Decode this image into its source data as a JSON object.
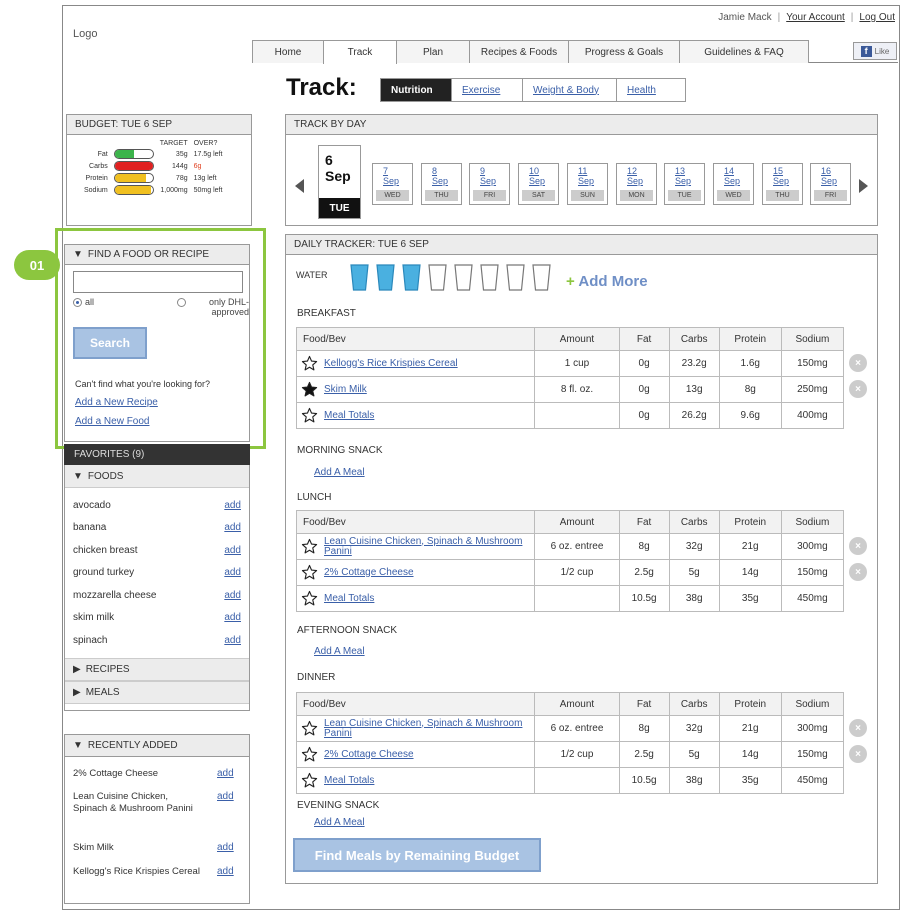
{
  "header": {
    "logo": "Logo",
    "user_name": "Jamie Mack",
    "your_account": "Your Account",
    "logout": "Log Out",
    "fb_like": "Like",
    "tabs": [
      {
        "label": "Home"
      },
      {
        "label": "Track"
      },
      {
        "label": "Plan"
      },
      {
        "label": "Recipes & Foods"
      },
      {
        "label": "Progress & Goals"
      },
      {
        "label": "Guidelines & FAQ"
      }
    ],
    "active_tab": "Track"
  },
  "page": {
    "title": "Track:",
    "subtabs": [
      {
        "label": "Nutrition"
      },
      {
        "label": "Exercise"
      },
      {
        "label": "Weight & Body"
      },
      {
        "label": "Health"
      }
    ],
    "active_subtab": "Nutrition"
  },
  "budget": {
    "header": "BUDGET: TUE 6 SEP",
    "col_target": "TARGET",
    "col_over": "OVER?",
    "rows": [
      {
        "label": "Fat",
        "target": "35g",
        "status": "17.5g left",
        "color": "#3cb44b",
        "fill": 0.5
      },
      {
        "label": "Carbs",
        "target": "144g",
        "status": "6g",
        "color": "#e02020",
        "fill": 1.0,
        "status_color": "#e04020"
      },
      {
        "label": "Protein",
        "target": "78g",
        "status": "13g left",
        "color": "#f0c020",
        "fill": 0.83
      },
      {
        "label": "Sodium",
        "target": "1,000mg",
        "status": "50mg left",
        "color": "#f0c020",
        "fill": 0.95
      }
    ]
  },
  "annotation": {
    "badge": "01"
  },
  "find": {
    "header": "FIND A FOOD OR RECIPE",
    "search_value": "",
    "radio_all": "all",
    "radio_dhl": "only DHL-approved",
    "search_button": "Search",
    "question": "Can't find what you're looking for?",
    "add_recipe": "Add a New Recipe",
    "add_food": "Add a New Food"
  },
  "favorites": {
    "header": "FAVORITES (9)",
    "foods_header": "FOODS",
    "foods": [
      {
        "name": "avocado",
        "add": "add"
      },
      {
        "name": "banana",
        "add": "add"
      },
      {
        "name": "chicken breast",
        "add": "add"
      },
      {
        "name": "ground turkey",
        "add": "add"
      },
      {
        "name": "mozzarella cheese",
        "add": "add"
      },
      {
        "name": "skim milk",
        "add": "add"
      },
      {
        "name": "spinach",
        "add": "add"
      }
    ],
    "recipes_header": "RECIPES",
    "meals_header": "MEALS"
  },
  "recent": {
    "header": "RECENTLY ADDED",
    "items": [
      {
        "name": "2% Cottage Cheese",
        "add": "add"
      },
      {
        "name": "Lean Cuisine Chicken, Spinach & Mushroom Panini",
        "add": "add"
      },
      {
        "name": "Skim Milk",
        "add": "add"
      },
      {
        "name": "Kellogg's Rice Krispies Cereal",
        "add": "add"
      }
    ]
  },
  "track_by_day": {
    "header": "TRACK BY DAY",
    "today": {
      "day": "6",
      "month": "Sep",
      "weekday": "TUE"
    },
    "days": [
      {
        "day": "7",
        "month": "Sep",
        "weekday": "WED"
      },
      {
        "day": "8",
        "month": "Sep",
        "weekday": "THU"
      },
      {
        "day": "9",
        "month": "Sep",
        "weekday": "FRI"
      },
      {
        "day": "10",
        "month": "Sep",
        "weekday": "SAT"
      },
      {
        "day": "11",
        "month": "Sep",
        "weekday": "SUN"
      },
      {
        "day": "12",
        "month": "Sep",
        "weekday": "MON"
      },
      {
        "day": "13",
        "month": "Sep",
        "weekday": "TUE"
      },
      {
        "day": "14",
        "month": "Sep",
        "weekday": "WED"
      },
      {
        "day": "15",
        "month": "Sep",
        "weekday": "THU"
      },
      {
        "day": "16",
        "month": "Sep",
        "weekday": "FRI"
      }
    ]
  },
  "daily": {
    "header": "DAILY TRACKER: TUE 6 SEP",
    "water_label": "WATER",
    "water_filled": 3,
    "water_total": 8,
    "water_color": "#4ab0e0",
    "add_more": "Add More",
    "columns": [
      "Food/Bev",
      "Amount",
      "Fat",
      "Carbs",
      "Protein",
      "Sodium"
    ],
    "add_meal": "Add A Meal",
    "meals": [
      {
        "name": "BREAKFAST",
        "rows": [
          {
            "food": "Kellogg's Rice Krispies Cereal",
            "amount": "1 cup",
            "fat": "0g",
            "carbs": "23.2g",
            "protein": "1.6g",
            "sodium": "150mg",
            "fav": false
          },
          {
            "food": "Skim Milk",
            "amount": "8 fl. oz.",
            "fat": "0g",
            "carbs": "13g",
            "protein": "8g",
            "sodium": "250mg",
            "fav": true
          }
        ],
        "totals": {
          "food": "Meal Totals",
          "amount": "",
          "fat": "0g",
          "carbs": "26.2g",
          "protein": "9.6g",
          "sodium": "400mg"
        }
      },
      {
        "name": "MORNING SNACK"
      },
      {
        "name": "LUNCH",
        "rows": [
          {
            "food": "Lean Cuisine Chicken, Spinach & Mushroom Panini",
            "amount": "6 oz. entree",
            "fat": "8g",
            "carbs": "32g",
            "protein": "21g",
            "sodium": "300mg",
            "fav": false
          },
          {
            "food": "2% Cottage Cheese",
            "amount": "1/2 cup",
            "fat": "2.5g",
            "carbs": "5g",
            "protein": "14g",
            "sodium": "150mg",
            "fav": false
          }
        ],
        "totals": {
          "food": "Meal Totals",
          "amount": "",
          "fat": "10.5g",
          "carbs": "38g",
          "protein": "35g",
          "sodium": "450mg"
        }
      },
      {
        "name": "AFTERNOON SNACK"
      },
      {
        "name": "DINNER",
        "rows": [
          {
            "food": "Lean Cuisine Chicken, Spinach & Mushroom Panini",
            "amount": "6 oz. entree",
            "fat": "8g",
            "carbs": "32g",
            "protein": "21g",
            "sodium": "300mg",
            "fav": false
          },
          {
            "food": "2% Cottage Cheese",
            "amount": "1/2 cup",
            "fat": "2.5g",
            "carbs": "5g",
            "protein": "14g",
            "sodium": "150mg",
            "fav": false
          }
        ],
        "totals": {
          "food": "Meal Totals",
          "amount": "",
          "fat": "10.5g",
          "carbs": "38g",
          "protein": "35g",
          "sodium": "450mg"
        }
      },
      {
        "name": "EVENING SNACK"
      }
    ],
    "find_meals_button": "Find Meals by Remaining Budget"
  }
}
